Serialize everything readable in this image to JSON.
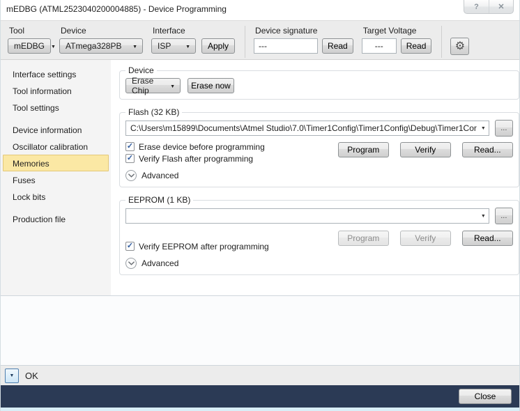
{
  "window": {
    "title": "mEDBG (ATML2523040200004885) - Device Programming"
  },
  "icons": {
    "help": "?",
    "close": "✕",
    "gear": "⚙",
    "dropdown_arrow": "▼",
    "check": "✓",
    "ellipsis": "..."
  },
  "toolbar": {
    "tool_label": "Tool",
    "tool_value": "mEDBG",
    "device_label": "Device",
    "device_value": "ATmega328PB",
    "interface_label": "Interface",
    "interface_value": "ISP",
    "apply_label": "Apply",
    "signature_label": "Device signature",
    "signature_value": "---",
    "signature_read_label": "Read",
    "voltage_label": "Target Voltage",
    "voltage_value": "---",
    "voltage_read_label": "Read"
  },
  "sidebar": {
    "items": [
      {
        "label": "Interface settings",
        "selected": false,
        "group_start": false
      },
      {
        "label": "Tool information",
        "selected": false,
        "group_start": false
      },
      {
        "label": "Tool settings",
        "selected": false,
        "group_start": false
      },
      {
        "label": "Device information",
        "selected": false,
        "group_start": true
      },
      {
        "label": "Oscillator calibration",
        "selected": false,
        "group_start": false
      },
      {
        "label": "Memories",
        "selected": true,
        "group_start": false
      },
      {
        "label": "Fuses",
        "selected": false,
        "group_start": false
      },
      {
        "label": "Lock bits",
        "selected": false,
        "group_start": false
      },
      {
        "label": "Production file",
        "selected": false,
        "group_start": true
      }
    ]
  },
  "main": {
    "device": {
      "title": "Device",
      "erase_mode_value": "Erase Chip",
      "erase_now_label": "Erase now"
    },
    "flash": {
      "title": "Flash (32 KB)",
      "file_path": "C:\\Users\\m15899\\Documents\\Atmel Studio\\7.0\\Timer1Config\\Timer1Config\\Debug\\Timer1Cor",
      "erase_checkbox_label": "Erase device before programming",
      "verify_checkbox_label": "Verify Flash after programming",
      "advanced_label": "Advanced",
      "program_label": "Program",
      "verify_label": "Verify",
      "read_label": "Read..."
    },
    "eeprom": {
      "title": "EEPROM (1 KB)",
      "file_path": "",
      "verify_checkbox_label": "Verify EEPROM after programming",
      "advanced_label": "Advanced",
      "program_label": "Program",
      "verify_label": "Verify",
      "read_label": "Read..."
    }
  },
  "statusbar": {
    "message": "OK"
  },
  "footer": {
    "close_label": "Close"
  }
}
